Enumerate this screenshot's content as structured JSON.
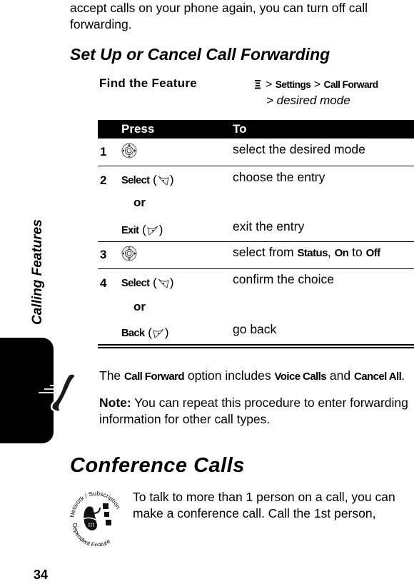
{
  "intro": {
    "text": "accept calls on your phone again, you can turn off call forwarding."
  },
  "section": {
    "title": "Set Up or Cancel Call Forwarding",
    "find_feature": {
      "label": "Find the Feature",
      "menu_icon": "menu-key-icon",
      "path": [
        ">",
        "Settings",
        ">",
        "Call Forward"
      ],
      "path_last": "> desired mode"
    },
    "table": {
      "headers": {
        "press": "Press",
        "to": "To"
      },
      "rows": [
        {
          "num": "1",
          "press_icon": "nav-key-icon",
          "to": "select the desired mode"
        },
        {
          "num": "2",
          "press": "Select",
          "press_icon": "right-soft-key-icon",
          "to": "choose the entry",
          "or": "or",
          "alt_press": "Exit",
          "alt_icon": "left-soft-key-icon",
          "alt_to": "exit the entry"
        },
        {
          "num": "3",
          "press_icon": "nav-key-icon",
          "to_prefix": "select from ",
          "to_b1": "Status",
          "to_sep": ", ",
          "to_b2": "On",
          "to_mid": " to ",
          "to_b3": "Off"
        },
        {
          "num": "4",
          "press": "Select",
          "press_icon": "right-soft-key-icon",
          "to": "confirm the choice",
          "or": "or",
          "alt_press": "Back",
          "alt_icon": "left-soft-key-icon",
          "alt_to": "go back"
        }
      ]
    }
  },
  "side_tab": {
    "label": "Calling Features",
    "icon": "phone-handset-icon"
  },
  "notes": {
    "n1_pre": "The ",
    "n1_b1": "Call Forward",
    "n1_mid": " option includes ",
    "n1_b2": "Voice Calls",
    "n1_and": " and ",
    "n1_b3": "Cancel All",
    "n1_end": ".",
    "n2_label": "Note:",
    "n2_text": " You can repeat this procedure to enter forwarding information for other call types."
  },
  "conference": {
    "title": "Conference Calls",
    "badge_top": "Network / Subscription",
    "badge_bottom": "Dependent Feature",
    "text": "To talk to more than 1 person on a call, you can make a conference call. Call the 1st person,"
  },
  "page_number": "34"
}
